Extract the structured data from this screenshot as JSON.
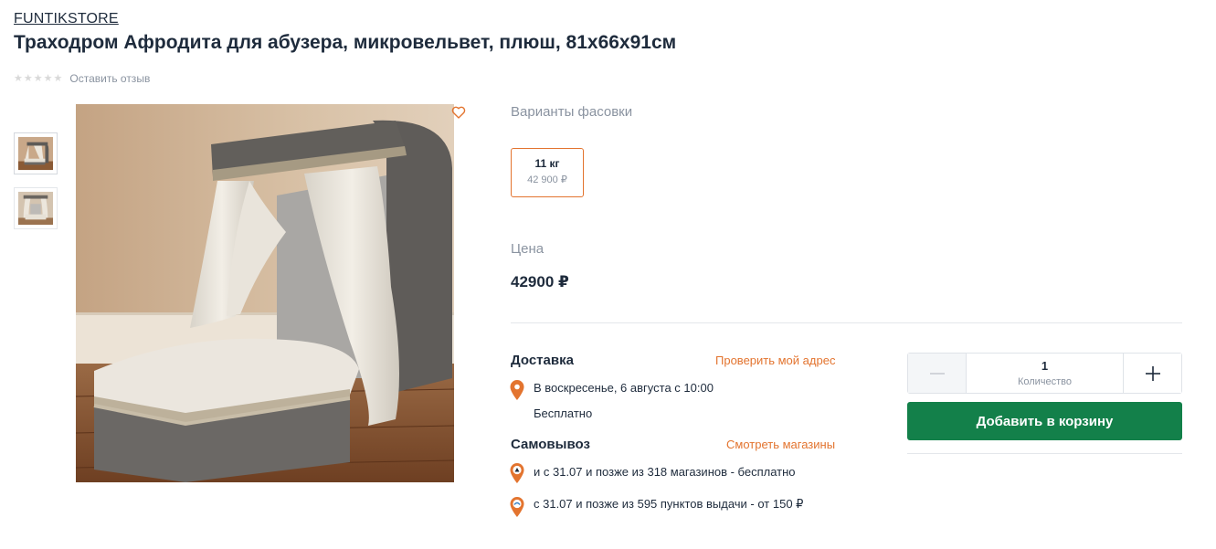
{
  "store": {
    "name": "FUNTIKSTORE"
  },
  "product": {
    "title": "Траходром Афродита для абузера, микровельвет, плюш, 81х66х91см"
  },
  "rating": {
    "stars": 0,
    "max_stars": 5,
    "review_link": "Оставить отзыв"
  },
  "gallery": {
    "thumbnails": [
      {
        "name": "thumb-1",
        "active": true
      },
      {
        "name": "thumb-2",
        "active": false
      }
    ],
    "favorite_icon": "heart-icon"
  },
  "packing": {
    "label": "Варианты фасовки",
    "options": [
      {
        "weight": "11 кг",
        "price": "42 900 ₽",
        "selected": true
      }
    ]
  },
  "price": {
    "label": "Цена",
    "value": "42900 ₽"
  },
  "delivery": {
    "title": "Доставка",
    "check_link": "Проверить мой адрес",
    "date": "В воскресенье, 6 августа с 10:00",
    "cost": "Бесплатно",
    "icon": "location-pin-icon"
  },
  "pickup": {
    "title": "Самовывоз",
    "stores_link": "Смотреть магазины",
    "options": [
      {
        "text": "и с 31.07 и позже из 318 магазинов - бесплатно",
        "icon": "store-pin-icon"
      },
      {
        "text": "с 31.07 и позже из 595 пунктов выдачи - от 150 ₽",
        "icon": "pickup-point-pin-icon"
      }
    ]
  },
  "quantity": {
    "value": "1",
    "label": "Количество",
    "minus_icon": "minus-icon",
    "plus_icon": "plus-icon"
  },
  "cart": {
    "button_label": "Добавить в корзину"
  },
  "colors": {
    "accent": "#e3742f",
    "primary_button": "#13804a",
    "text": "#1e2b3c",
    "muted": "#8a93a0"
  }
}
